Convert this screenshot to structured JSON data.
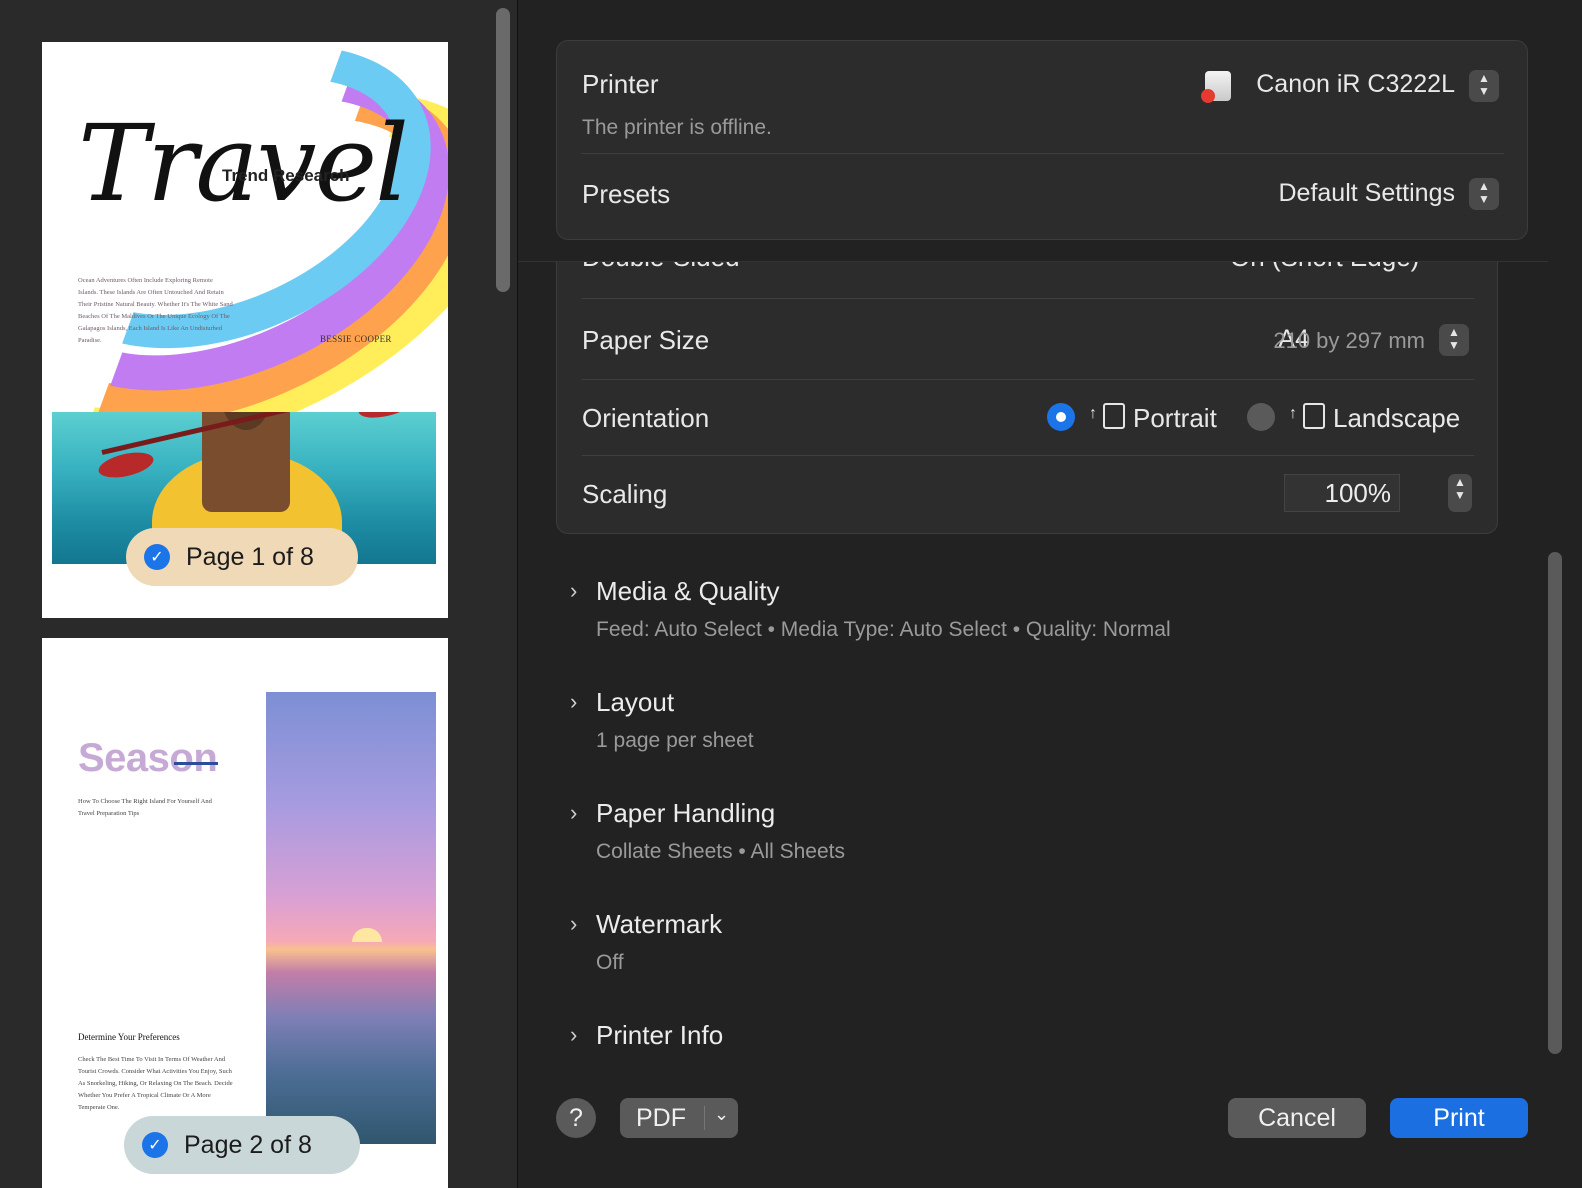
{
  "preview": {
    "page1": {
      "title_script": "Travel",
      "subtitle": "Trend Research",
      "intro": "Ocean Adventures Often Include Exploring Remote Islands. These Islands Are Often Untouched And Retain Their Pristine Natural Beauty. Whether It's The White Sand Beaches Of The Maldives Or The Unique Ecology Of The Galapagos Islands, Each Island Is Like An Undisturbed Paradise.",
      "author": "BESSIE COOPER",
      "badge": "Page 1 of 8"
    },
    "page2": {
      "title": "Season",
      "subtitle": "How To Choose The Right Island For Yourself And Travel Preparation Tips",
      "heading": "Determine Your Preferences",
      "body": "Check The Best Time To Visit In Terms Of Weather And Tourist Crowds. Consider What Activities You Enjoy, Such As Snorkeling, Hiking, Or Relaxing On The Beach. Decide Whether You Prefer A Tropical Climate Or A More Temperate One.",
      "badge": "Page 2 of 8"
    }
  },
  "printer": {
    "label": "Printer",
    "name": "Canon iR C3222L",
    "status": "The printer is offline."
  },
  "presets": {
    "label": "Presets",
    "value": "Default Settings"
  },
  "double_sided": {
    "label": "Double-Sided",
    "value": "On (Short Edge)"
  },
  "paper_size": {
    "label": "Paper Size",
    "value": "A4",
    "detail": "210 by 297 mm"
  },
  "orientation": {
    "label": "Orientation",
    "portrait": "Portrait",
    "landscape": "Landscape",
    "selected": "Portrait"
  },
  "scaling": {
    "label": "Scaling",
    "value": "100%"
  },
  "sections": [
    {
      "title": "Media & Quality",
      "summary": "Feed: Auto Select • Media Type: Auto Select • Quality: Normal"
    },
    {
      "title": "Layout",
      "summary": "1 page per sheet"
    },
    {
      "title": "Paper Handling",
      "summary": "Collate Sheets • All Sheets"
    },
    {
      "title": "Watermark",
      "summary": "Off"
    },
    {
      "title": "Printer Info",
      "summary": ""
    }
  ],
  "buttons": {
    "help": "?",
    "pdf": "PDF",
    "cancel": "Cancel",
    "print": "Print"
  },
  "colors": {
    "accent": "#1b74e8",
    "print_button": "#1b6fe0",
    "status_dot": "#e53a2f"
  }
}
